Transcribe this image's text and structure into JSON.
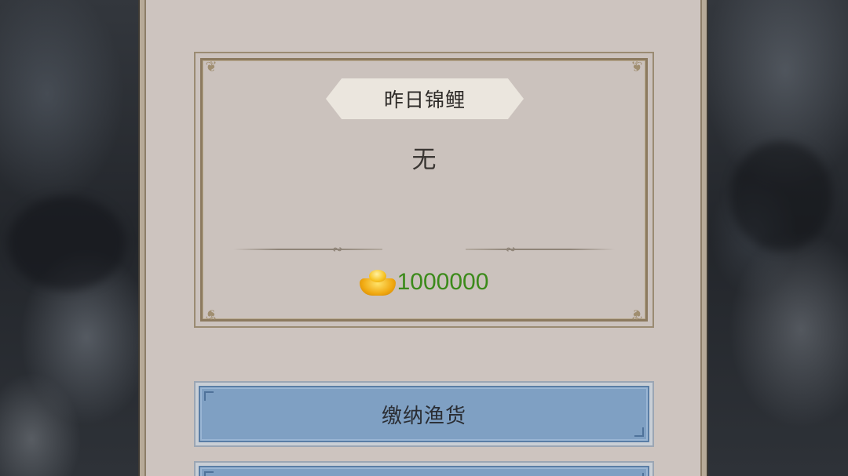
{
  "koi_card": {
    "title": "昨日锦鲤",
    "winner": "无",
    "reward_icon": "gold-ingot-icon",
    "reward_amount": "1000000"
  },
  "buttons": {
    "submit_fish": "缴纳渔货",
    "second": ""
  },
  "colors": {
    "panel_bg": "#cdc4bf",
    "button_blue": "#7fa0c3",
    "reward_green": "#3b8a1a"
  }
}
